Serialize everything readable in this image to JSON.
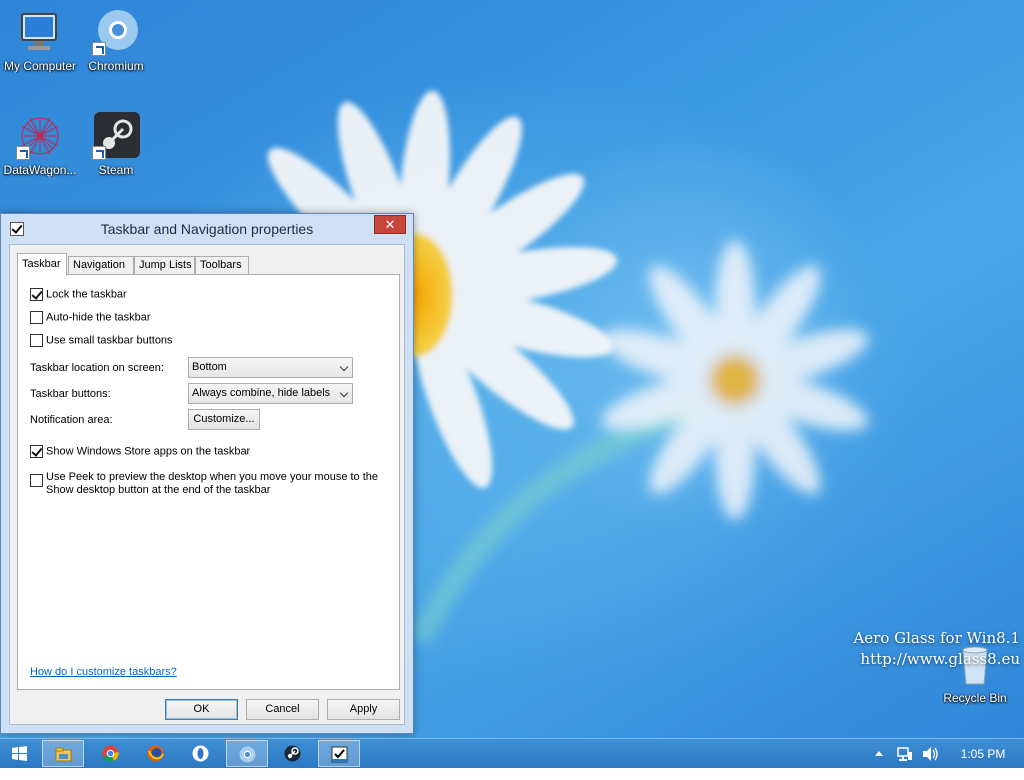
{
  "desktop": {
    "icons": [
      {
        "label": "My Computer",
        "icon": "computer-icon"
      },
      {
        "label": "Chromium",
        "icon": "chromium-icon"
      },
      {
        "label": "DataWagon...",
        "icon": "datawagon-icon"
      },
      {
        "label": "Steam",
        "icon": "steam-icon"
      },
      {
        "label": "Recycle Bin",
        "icon": "recycle-bin-icon"
      }
    ],
    "watermark": {
      "line1": "Aero Glass for Win8.1",
      "line2": "http://www.glass8.eu"
    }
  },
  "dialog": {
    "title": "Taskbar and Navigation properties",
    "close_label": "✕",
    "tabs": [
      {
        "label": "Taskbar",
        "active": true
      },
      {
        "label": "Navigation",
        "active": false
      },
      {
        "label": "Jump Lists",
        "active": false
      },
      {
        "label": "Toolbars",
        "active": false
      }
    ],
    "options": {
      "lock_taskbar": {
        "label": "Lock the taskbar",
        "checked": true
      },
      "auto_hide": {
        "label": "Auto-hide the taskbar",
        "checked": false
      },
      "small_buttons": {
        "label": "Use small taskbar buttons",
        "checked": false
      }
    },
    "location": {
      "label": "Taskbar location on screen:",
      "value": "Bottom"
    },
    "buttons_setting": {
      "label": "Taskbar buttons:",
      "value": "Always combine, hide labels"
    },
    "notification": {
      "label": "Notification area:",
      "button": "Customize..."
    },
    "store_apps": {
      "label": "Show Windows Store apps on the taskbar",
      "checked": true
    },
    "peek": {
      "line1": "Use Peek to preview the desktop when you move your mouse to the",
      "line2": "Show desktop button at the end of the taskbar",
      "checked": false
    },
    "help_link": "How do I customize taskbars?",
    "ok": "OK",
    "cancel": "Cancel",
    "apply": "Apply"
  },
  "taskbar": {
    "items": [
      {
        "icon": "start-icon"
      },
      {
        "icon": "file-explorer-icon"
      },
      {
        "icon": "chrome-icon"
      },
      {
        "icon": "firefox-icon"
      },
      {
        "icon": "opera-icon"
      },
      {
        "icon": "chromium-icon"
      },
      {
        "icon": "steam-icon"
      },
      {
        "icon": "taskbar-properties-icon"
      }
    ],
    "tray": {
      "clock": "1:05 PM"
    }
  }
}
